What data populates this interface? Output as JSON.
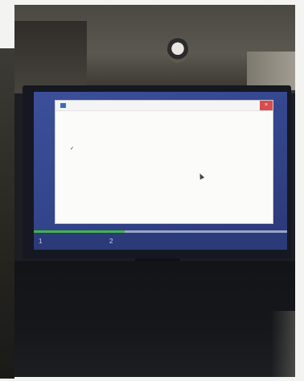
{
  "scene": {
    "type": "photo of a monitor showing an installer",
    "colors": {
      "installer_background": "#33458c",
      "dialog_background": "#fbfbfa",
      "heading_blue": "#2f5aa4",
      "close_button_red": "#d84d4d",
      "progress_green": "#44b24a"
    }
  },
  "installer": {
    "window_title": "",
    "heading": "",
    "section_label": "",
    "steps": [
      {
        "label": "",
        "status": "done",
        "icon": "check-icon"
      },
      {
        "label": "",
        "status": "current",
        "icon": ""
      },
      {
        "label": "",
        "status": "pending",
        "icon": ""
      },
      {
        "label": "",
        "status": "pending",
        "icon": ""
      },
      {
        "label": "",
        "status": "pending",
        "icon": ""
      }
    ],
    "close_icon": "close-icon",
    "progress_fraction": 0.36,
    "stages": [
      {
        "number": "1",
        "label": ""
      },
      {
        "number": "2",
        "label": ""
      }
    ]
  }
}
